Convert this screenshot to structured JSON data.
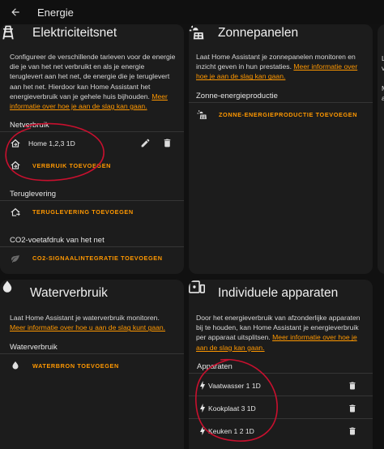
{
  "topbar": {
    "title": "Energie"
  },
  "grid": {
    "title": "Elektriciteitsnet",
    "description": "Configureer de verschillende tarieven voor de energie die je van het net verbruikt en als je energie teruglevert aan het net, de energie die je teruglevert aan het net. Hierdoor kan Home Assistant het energieverbruik van je gehele huis bijhouden.",
    "link": "Meer informatie over hoe je aan de slag kan gaan.",
    "consumption_title": "Netverbruik",
    "consumption_item": "Home 1,2,3 1D",
    "add_consumption": "VERBRUIK TOEVOEGEN",
    "return_title": "Teruglevering",
    "add_return": "TERUGLEVERING TOEVOEGEN",
    "co2_title": "CO2-voetafdruk van het net",
    "add_co2": "CO2-SIGNAALINTEGRATIE TOEVOEGEN"
  },
  "solar": {
    "title": "Zonnepanelen",
    "description": "Laat Home Assistant je zonnepanelen monitoren en inzicht geven in hun prestaties.",
    "link": "Meer informatie over hoe je aan de slag kan gaan.",
    "section_title": "Zonne-energieproductie",
    "add_solar": "ZONNE-ENERGIEPRODUCTIE TOEVOEGEN"
  },
  "water": {
    "title": "Waterverbruik",
    "description": "Laat Home Assistant je waterverbruik monitoren.",
    "link": "Meer informatie over hoe u aan de slag kunt gaan.",
    "section_title": "Waterverbruik",
    "add_water": "WATERBRON TOEVOEGEN"
  },
  "devices": {
    "title": "Individuele apparaten",
    "description": "Door het energieverbruik van afzonderlijke apparaten bij te houden, kan Home Assistant je energieverbruik per apparaat uitsplitsen.",
    "link": "Meer informatie over hoe je aan de slag kan gaan.",
    "section_title": "Apparaten",
    "items": [
      "Vaatwasser 1 1D",
      "Kookplaat 3 1D",
      "Keuken 1 2 1D"
    ]
  },
  "colors": {
    "accent": "#ff9800",
    "annotation": "#c8102e",
    "card": "#1c1c1c",
    "background": "#111111"
  }
}
